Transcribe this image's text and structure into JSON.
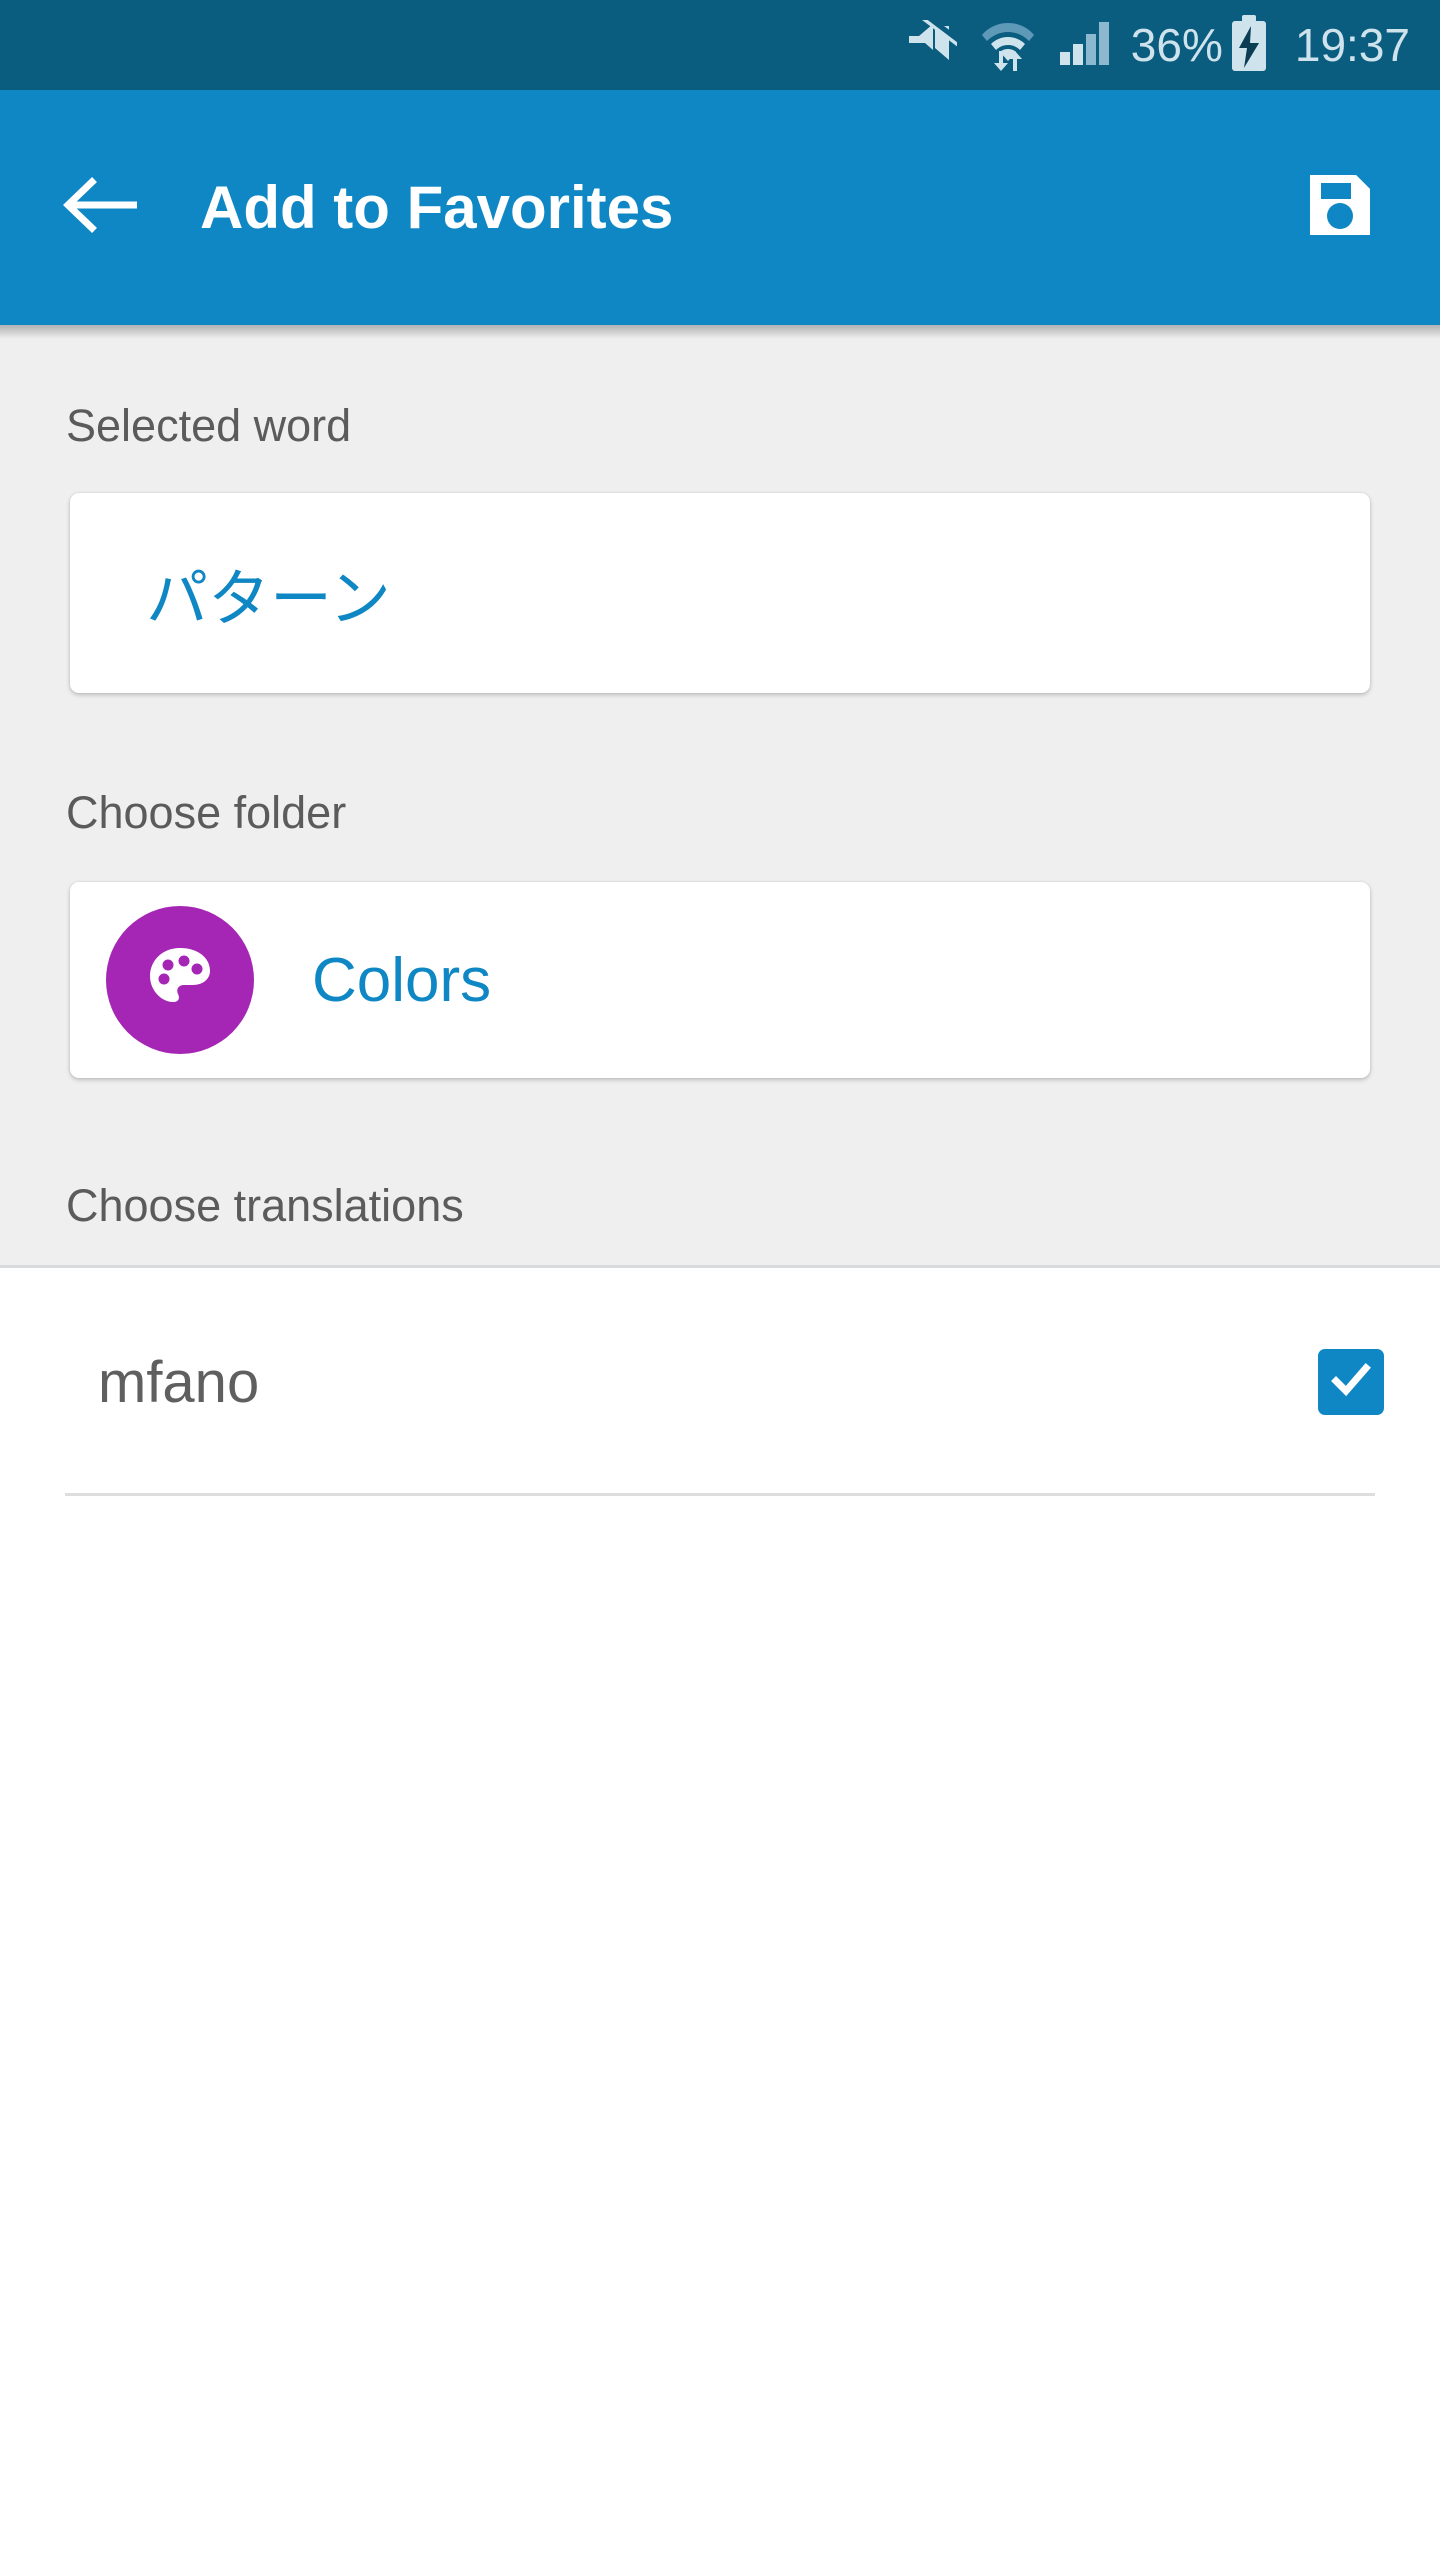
{
  "status_bar": {
    "battery_percent": "36%",
    "clock": "19:37",
    "icons": [
      "mute-icon",
      "wifi-icon",
      "signal-icon",
      "battery-charging-icon"
    ],
    "background_color": "#0b5d80",
    "foreground_color": "#cfe3ec"
  },
  "app_bar": {
    "title": "Add to Favorites",
    "back_icon": "back-arrow-icon",
    "save_icon": "save-floppy-icon",
    "background_color": "#0f87c4",
    "title_color": "#ffffff"
  },
  "sections": {
    "selected_word_label": "Selected word",
    "choose_folder_label": "Choose folder",
    "choose_translations_label": "Choose translations"
  },
  "selected_word": {
    "value": "パターン",
    "value_color": "#0f87c4"
  },
  "folder": {
    "name": "Colors",
    "icon": "palette-icon",
    "icon_background_color": "#a526b5",
    "name_color": "#0f87c4"
  },
  "translations": [
    {
      "label": "mfano",
      "checked": true
    }
  ],
  "colors": {
    "accent": "#0f87c4",
    "content_background": "#efefef",
    "card_background": "#ffffff",
    "label_text": "#5b5b5b",
    "list_text": "#5f5f5f",
    "divider": "#dedede"
  }
}
